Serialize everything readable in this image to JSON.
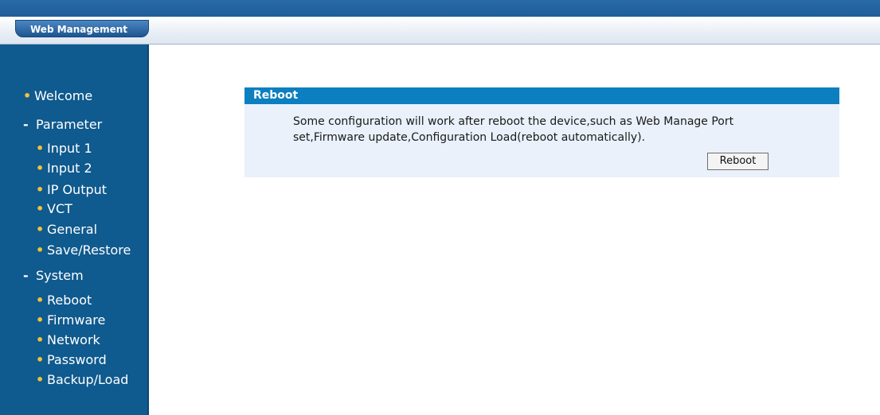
{
  "header": {
    "tab_label": "Web Management"
  },
  "sidebar": {
    "welcome": "Welcome",
    "parameter": {
      "label": "Parameter",
      "items": [
        "Input 1",
        "Input 2",
        "IP Output",
        "VCT",
        "General",
        "Save/Restore"
      ]
    },
    "system": {
      "label": "System",
      "items": [
        "Reboot",
        "Firmware",
        "Network",
        "Password",
        "Backup/Load"
      ]
    },
    "bullet_symbol": "•",
    "expanded_symbol": "-"
  },
  "main": {
    "panel_title": "Reboot",
    "description": "Some configuration will work after reboot the device,such as Web Manage Port set,Firmware update,Configuration Load(reboot automatically).",
    "button_label": "Reboot"
  },
  "colors": {
    "top_bar": "#1f5c99",
    "sidebar_bg": "#0f5a8e",
    "panel_header": "#0b7fc0",
    "panel_body": "#eaf1fb",
    "bullet": "#f2c23a"
  }
}
